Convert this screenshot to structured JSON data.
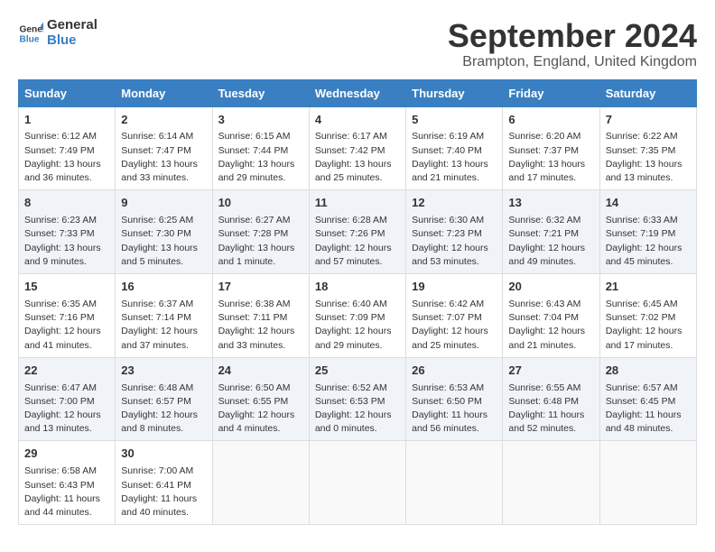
{
  "logo": {
    "general": "General",
    "blue": "Blue"
  },
  "title": "September 2024",
  "location": "Brampton, England, United Kingdom",
  "weekdays": [
    "Sunday",
    "Monday",
    "Tuesday",
    "Wednesday",
    "Thursday",
    "Friday",
    "Saturday"
  ],
  "weeks": [
    [
      {
        "day": "1",
        "sunrise": "6:12 AM",
        "sunset": "7:49 PM",
        "daylight": "13 hours and 36 minutes."
      },
      {
        "day": "2",
        "sunrise": "6:14 AM",
        "sunset": "7:47 PM",
        "daylight": "13 hours and 33 minutes."
      },
      {
        "day": "3",
        "sunrise": "6:15 AM",
        "sunset": "7:44 PM",
        "daylight": "13 hours and 29 minutes."
      },
      {
        "day": "4",
        "sunrise": "6:17 AM",
        "sunset": "7:42 PM",
        "daylight": "13 hours and 25 minutes."
      },
      {
        "day": "5",
        "sunrise": "6:19 AM",
        "sunset": "7:40 PM",
        "daylight": "13 hours and 21 minutes."
      },
      {
        "day": "6",
        "sunrise": "6:20 AM",
        "sunset": "7:37 PM",
        "daylight": "13 hours and 17 minutes."
      },
      {
        "day": "7",
        "sunrise": "6:22 AM",
        "sunset": "7:35 PM",
        "daylight": "13 hours and 13 minutes."
      }
    ],
    [
      {
        "day": "8",
        "sunrise": "6:23 AM",
        "sunset": "7:33 PM",
        "daylight": "13 hours and 9 minutes."
      },
      {
        "day": "9",
        "sunrise": "6:25 AM",
        "sunset": "7:30 PM",
        "daylight": "13 hours and 5 minutes."
      },
      {
        "day": "10",
        "sunrise": "6:27 AM",
        "sunset": "7:28 PM",
        "daylight": "13 hours and 1 minute."
      },
      {
        "day": "11",
        "sunrise": "6:28 AM",
        "sunset": "7:26 PM",
        "daylight": "12 hours and 57 minutes."
      },
      {
        "day": "12",
        "sunrise": "6:30 AM",
        "sunset": "7:23 PM",
        "daylight": "12 hours and 53 minutes."
      },
      {
        "day": "13",
        "sunrise": "6:32 AM",
        "sunset": "7:21 PM",
        "daylight": "12 hours and 49 minutes."
      },
      {
        "day": "14",
        "sunrise": "6:33 AM",
        "sunset": "7:19 PM",
        "daylight": "12 hours and 45 minutes."
      }
    ],
    [
      {
        "day": "15",
        "sunrise": "6:35 AM",
        "sunset": "7:16 PM",
        "daylight": "12 hours and 41 minutes."
      },
      {
        "day": "16",
        "sunrise": "6:37 AM",
        "sunset": "7:14 PM",
        "daylight": "12 hours and 37 minutes."
      },
      {
        "day": "17",
        "sunrise": "6:38 AM",
        "sunset": "7:11 PM",
        "daylight": "12 hours and 33 minutes."
      },
      {
        "day": "18",
        "sunrise": "6:40 AM",
        "sunset": "7:09 PM",
        "daylight": "12 hours and 29 minutes."
      },
      {
        "day": "19",
        "sunrise": "6:42 AM",
        "sunset": "7:07 PM",
        "daylight": "12 hours and 25 minutes."
      },
      {
        "day": "20",
        "sunrise": "6:43 AM",
        "sunset": "7:04 PM",
        "daylight": "12 hours and 21 minutes."
      },
      {
        "day": "21",
        "sunrise": "6:45 AM",
        "sunset": "7:02 PM",
        "daylight": "12 hours and 17 minutes."
      }
    ],
    [
      {
        "day": "22",
        "sunrise": "6:47 AM",
        "sunset": "7:00 PM",
        "daylight": "12 hours and 13 minutes."
      },
      {
        "day": "23",
        "sunrise": "6:48 AM",
        "sunset": "6:57 PM",
        "daylight": "12 hours and 8 minutes."
      },
      {
        "day": "24",
        "sunrise": "6:50 AM",
        "sunset": "6:55 PM",
        "daylight": "12 hours and 4 minutes."
      },
      {
        "day": "25",
        "sunrise": "6:52 AM",
        "sunset": "6:53 PM",
        "daylight": "12 hours and 0 minutes."
      },
      {
        "day": "26",
        "sunrise": "6:53 AM",
        "sunset": "6:50 PM",
        "daylight": "11 hours and 56 minutes."
      },
      {
        "day": "27",
        "sunrise": "6:55 AM",
        "sunset": "6:48 PM",
        "daylight": "11 hours and 52 minutes."
      },
      {
        "day": "28",
        "sunrise": "6:57 AM",
        "sunset": "6:45 PM",
        "daylight": "11 hours and 48 minutes."
      }
    ],
    [
      {
        "day": "29",
        "sunrise": "6:58 AM",
        "sunset": "6:43 PM",
        "daylight": "11 hours and 44 minutes."
      },
      {
        "day": "30",
        "sunrise": "7:00 AM",
        "sunset": "6:41 PM",
        "daylight": "11 hours and 40 minutes."
      },
      null,
      null,
      null,
      null,
      null
    ]
  ],
  "labels": {
    "sunrise": "Sunrise:",
    "sunset": "Sunset:",
    "daylight": "Daylight:"
  }
}
